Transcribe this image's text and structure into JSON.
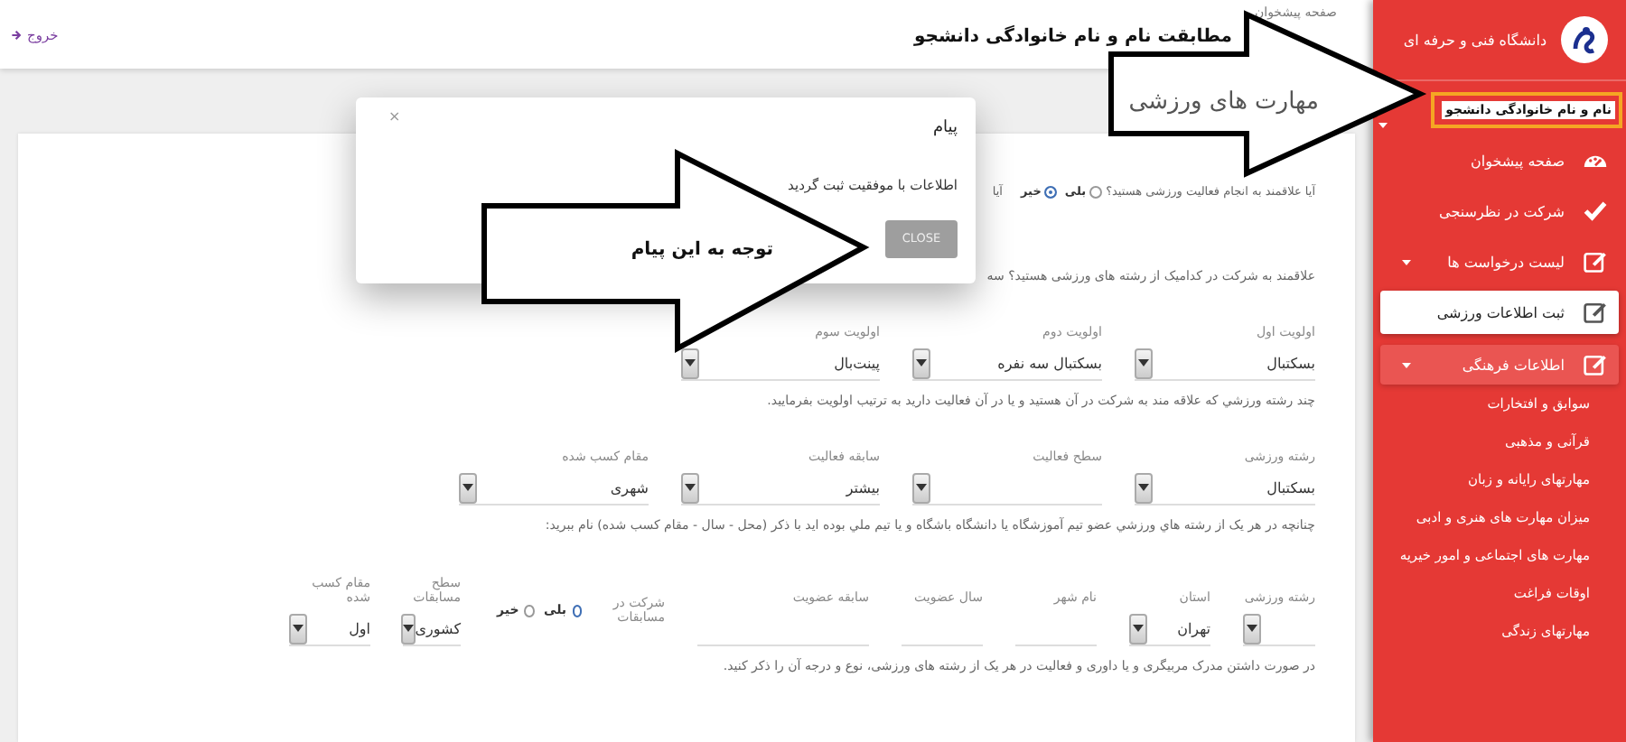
{
  "header": {
    "breadcrumb": "صفحه پیشخوان",
    "logout": "خروج"
  },
  "page_title": "مهارت های ورزشی",
  "sections": [
    {
      "kind": "radio_question",
      "label": "آیا علاقمند به انجام فعالیت ورزشی هستید؟",
      "options": [
        {
          "label": "بلی",
          "selected": false
        },
        {
          "label": "خیر",
          "selected": true
        }
      ],
      "next_text": "آیا"
    },
    {
      "kind": "text",
      "text": "علاقمند به شرکت در کدامیک از رشته های ورزشی هستید؟ سه"
    },
    {
      "kind": "fields",
      "fields": [
        {
          "kind": "select",
          "label": "اولویت اول",
          "value": "بسکتبال"
        },
        {
          "kind": "select",
          "label": "اولویت دوم",
          "value": "بسکتبال سه نفره"
        },
        {
          "kind": "select",
          "label": "اولویت سوم",
          "value": "پینت‌بال"
        }
      ]
    },
    {
      "kind": "text",
      "text": "چند رشته ورزشي كه علاقه مند به شركت در آن هستيد و يا در آن فعاليت داريد به ترتيب اولويت بفرماييد."
    },
    {
      "kind": "fields",
      "fields": [
        {
          "kind": "select",
          "label": "رشته ورزشی",
          "value": "بسکتبال"
        },
        {
          "kind": "select",
          "label": "سطح فعالیت"
        },
        {
          "kind": "select",
          "label": "سابقه فعالیت",
          "value": "بیشتر"
        },
        {
          "kind": "select",
          "label": "مقام کسب شده",
          "value": "شهری"
        }
      ]
    },
    {
      "kind": "text",
      "text": "چنانچه در هر یک از رشته هاي ورزشي عضو تيم آموزشگاه يا دانشگاه باشگاه و يا تيم ملي بوده ايد با ذكر (محل - سال - مقام كسب شده) نام ببريد:"
    },
    {
      "kind": "fields",
      "fields": [
        {
          "kind": "select",
          "label": "رشته ورزشی"
        },
        {
          "kind": "select",
          "label": "استان",
          "value": "تهران"
        },
        {
          "kind": "input",
          "label": "نام شهر"
        },
        {
          "kind": "input",
          "label": "سال عضویت"
        },
        {
          "kind": "input",
          "label": "سابقه عضویت"
        },
        {
          "kind": "radio",
          "label": "شرکت در مسابقات",
          "options": [
            {
              "label": "بلی",
              "selected": true
            },
            {
              "label": "خیر",
              "selected": false
            }
          ]
        },
        {
          "kind": "select",
          "label": "سطح مسابقات",
          "value": "کشوری"
        },
        {
          "kind": "select",
          "label": "مقام کسب شده",
          "value": "اول"
        }
      ]
    },
    {
      "kind": "text",
      "text": "در صورت داشتن مدرک مربیگری و یا داوری و فعالیت در هر یک از رشته های ورزشی، نوع و درجه آن را ذکر کنید."
    }
  ],
  "modal": {
    "title": "پیام",
    "close_symbol": "×",
    "message": "اطلاعات با موفقیت ثبت گردید",
    "button": "CLOSE"
  },
  "sidebar": {
    "brand": "دانشگاه فنی و حرفه ای",
    "user": "نام و نام خانوادگی دانشجو",
    "items": [
      {
        "label": "صفحه پیشخوان",
        "selected": false,
        "submenu": false,
        "expanded": false
      },
      {
        "label": "شرکت در نظرسنجی",
        "selected": false,
        "submenu": false,
        "expanded": false
      },
      {
        "label": "لیست درخواست ها",
        "selected": false,
        "submenu": true,
        "expanded": false
      },
      {
        "label": "ثبت اطلاعات ورزشی",
        "selected": true,
        "submenu": false,
        "expanded": false
      },
      {
        "label": "اطلاعات فرهنگی",
        "selected": false,
        "submenu": true,
        "expanded": true,
        "children": [
          {
            "label": "سوابق و افتخارات"
          },
          {
            "label": "قرآنی و مذهبی"
          },
          {
            "label": "مهارتهای رایانه و زبان"
          },
          {
            "label": "میزان مهارت های هنری و ادبی"
          },
          {
            "label": "مهارت های اجتماعی و امور خیریه"
          },
          {
            "label": "اوقات فراغت"
          },
          {
            "label": "مهارتهای زندگی"
          }
        ]
      }
    ]
  },
  "annotations": [
    {
      "text": "مطابقت نام و نام خانوادگی دانشجو"
    },
    {
      "text": "توجه به این پیام"
    }
  ]
}
